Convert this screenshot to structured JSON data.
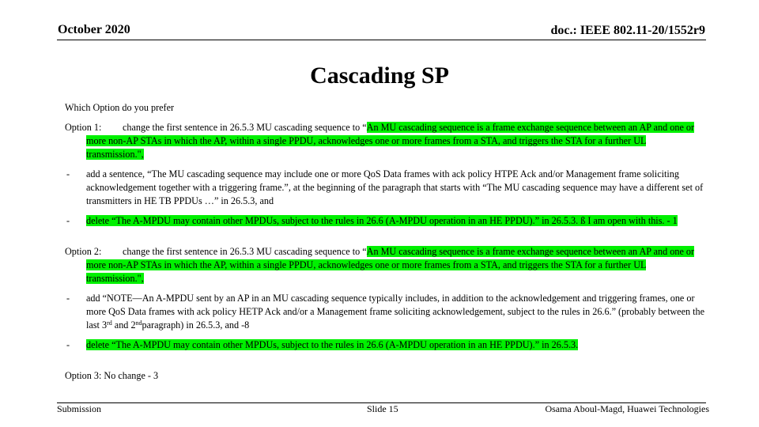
{
  "header": {
    "date": "October 2020",
    "doc_id": "doc.: IEEE 802.11-20/1552r9"
  },
  "title": "Cascading SP",
  "question": "Which Option do you prefer",
  "option1": {
    "label": "Option 1:",
    "intro": "change the first sentence in 26.5.3 MU cascading sequence to “",
    "highlight": "An MU cascading sequence is a frame exchange sequence between an AP and one or more non-AP STAs in which the AP, within a single PPDU, acknowledges one or more frames from a STA, and triggers the STA  for a further UL transmission.\",",
    "bullets": [
      {
        "dash": "-",
        "text": "add a sentence, “The MU cascading sequence may include one or more QoS Data frames with ack policy HTPE Ack and/or Management frame soliciting acknowledgement together with a triggering frame.”, at the beginning of the paragraph that starts with “The MU cascading sequence may have a different set of transmitters in HE TB PPDUs …” in 26.5.3, and",
        "highlighted": false
      },
      {
        "dash": "-",
        "text": "delete “The A-MPDU may contain other MPDUs, subject to the rules in 26.6 (A-MPDU operation in an HE PPDU).” in 26.5.3.  ß I am open with this.  - 1",
        "highlighted": true
      }
    ]
  },
  "option2": {
    "label": "Option 2:",
    "intro": "change the first sentence in 26.5.3 MU cascading sequence to “",
    "highlight": "An MU cascading sequence is a frame exchange sequence between an AP and one or more non-AP STAs in which the AP, within a single PPDU, acknowledges one or more frames from a STA, and triggers the STA  for a further UL transmission.\",",
    "bullets": [
      {
        "dash": "-",
        "text_before": "add “NOTE—An A-MPDU sent by an AP in an MU cascading sequence typically includes, in addition to the acknowledgement and triggering frames, one or more QoS Data frames with ack policy HETP Ack and/or a Management frame soliciting acknowledgement, subject to the rules in 26.6.” (probably between the last 3",
        "sup1": "rd",
        "text_mid": " and 2",
        "sup2": "nd",
        "text_after": "paragraph) in 26.5.3, and -8",
        "highlighted": false
      },
      {
        "dash": "-",
        "text": "delete “The A-MPDU may contain other MPDUs, subject to the rules in 26.6 (A-MPDU operation in an HE PPDU).” in 26.5.3.",
        "highlighted": true
      }
    ]
  },
  "option3": {
    "text": "Option 3: No change - 3"
  },
  "footer": {
    "left": "Submission",
    "center": "Slide 15",
    "right": "Osama Aboul-Magd, Huawei Technologies"
  },
  "colors": {
    "highlight": "#00f000",
    "text": "#000000",
    "background": "#ffffff"
  }
}
